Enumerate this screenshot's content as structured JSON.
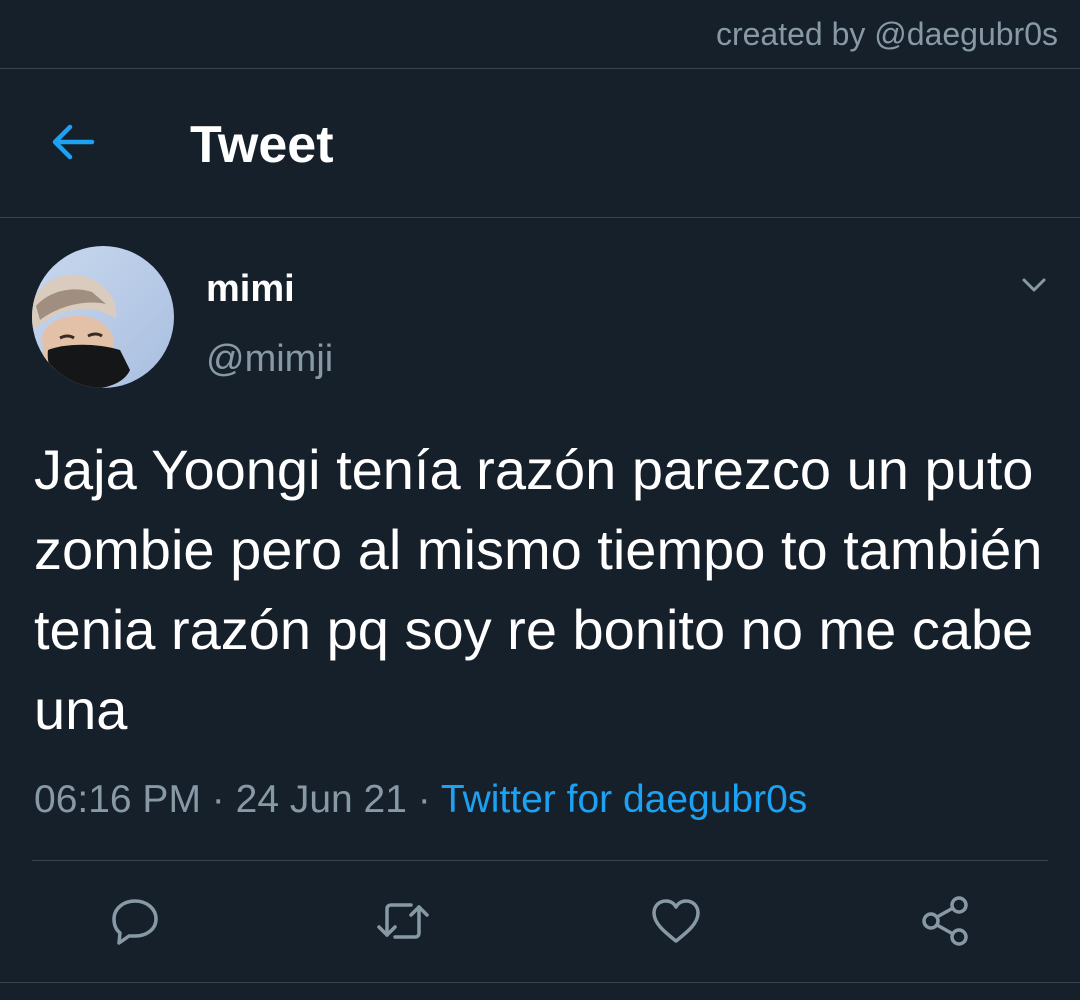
{
  "watermark": {
    "text": "created by @daegubr0s"
  },
  "header": {
    "back_icon": "arrow-left-icon",
    "title": "Tweet"
  },
  "tweet": {
    "author": {
      "name": "mimi",
      "handle": "@mimji",
      "avatar": "profile-photo"
    },
    "text": "Jaja Yoongi tenía razón parezco un puto zombie pero al mismo tiempo to también tenia razón pq soy re bonito no me cabe una",
    "time": "06:16 PM",
    "separator": "·",
    "date": "24 Jun 21",
    "source": "Twitter for daegubr0s"
  },
  "actions": [
    {
      "name": "reply",
      "icon": "comment-icon"
    },
    {
      "name": "retweet",
      "icon": "retweet-icon"
    },
    {
      "name": "like",
      "icon": "heart-icon"
    },
    {
      "name": "share",
      "icon": "share-icon"
    }
  ],
  "colors": {
    "background": "#15202b",
    "accent": "#1da1f2",
    "secondary_text": "#8899a6",
    "divider": "#38444d"
  }
}
